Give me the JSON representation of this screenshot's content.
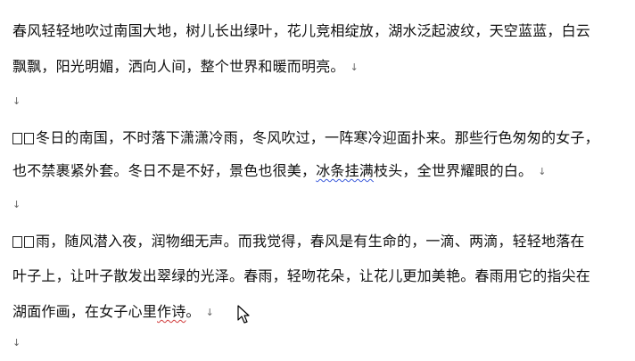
{
  "document": {
    "paragraph1": {
      "line1": "春风轻轻地吹过南国大地，树儿长出绿叶，花儿竞相绽放，湖水泛起波纹，天空蓝蓝，白云",
      "line2": "飘飘，阳光明媚，洒向人间，整个世界和暖而明亮。"
    },
    "paragraph2": {
      "line1": "冬日的南国，不时落下潇潇冷雨，冬风吹过，一阵寒冷迎面扑来。那些行色匆匆的女子，",
      "line2_before": "也不禁裹紧外套。冬日不是不好，景色也很美，",
      "line2_highlight": "冰条挂满",
      "line2_after": "枝头，全世界耀眼的白。"
    },
    "paragraph3": {
      "line1": "雨，随风潜入夜，润物细无声。而我觉得，春风是有生命的，一滴、两滴，轻轻地落在",
      "line2": "叶子上，让叶子散发出翠绿的光泽。春雨，轻吻花朵，让花儿更加美艳。春雨用它的指尖在",
      "line3_before": "湖面作画，在女子心里",
      "line3_highlight": "作诗",
      "line3_after": "。"
    },
    "paragraph_mark": "↓"
  }
}
